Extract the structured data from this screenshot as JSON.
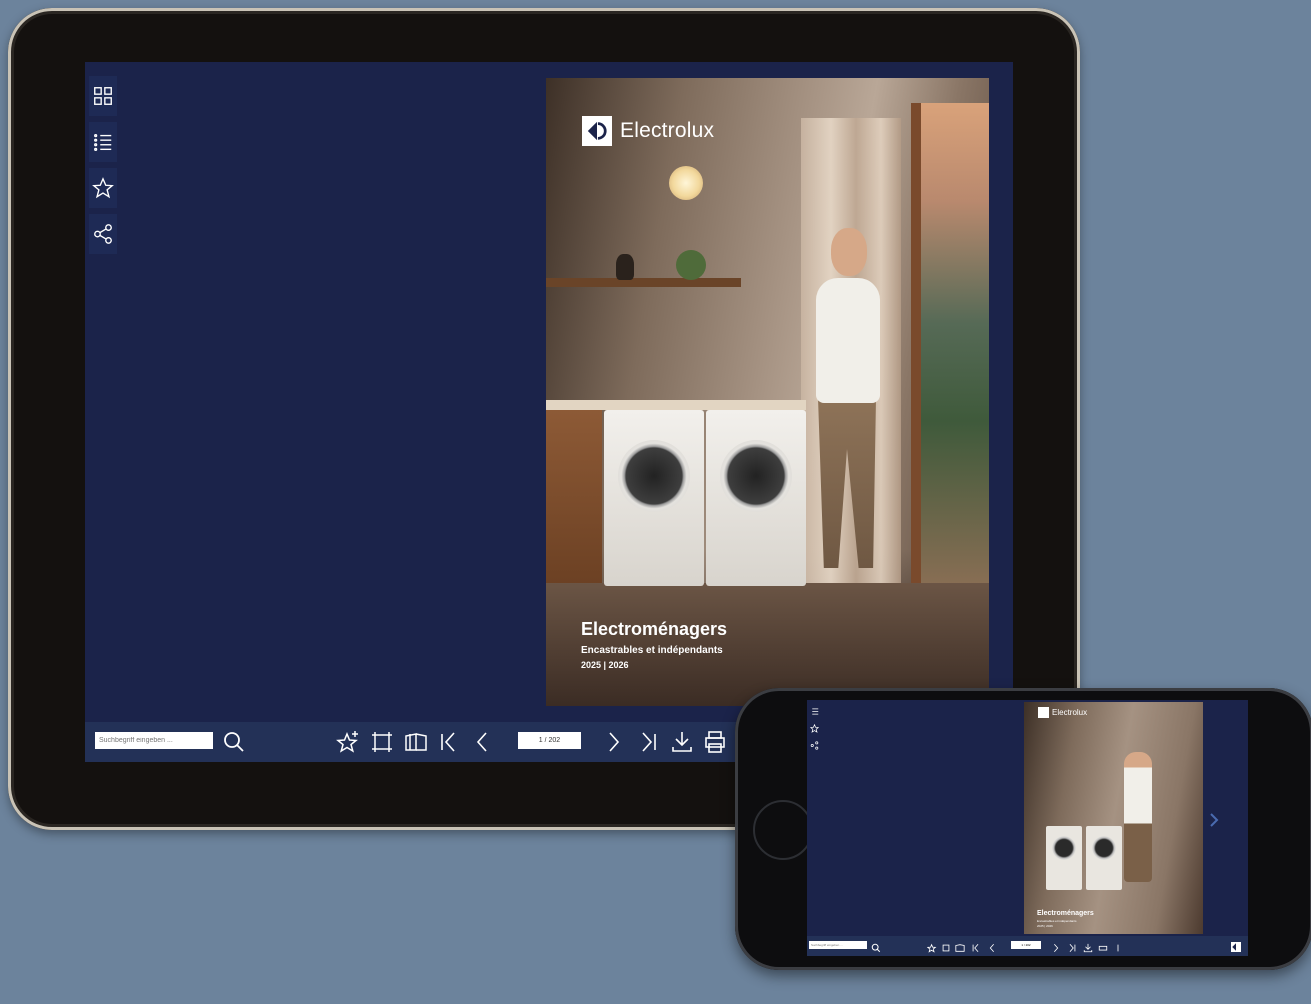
{
  "tablet": {
    "sidebar": {
      "items": [
        {
          "name": "thumbnails",
          "icon": "grid-icon"
        },
        {
          "name": "table-of-contents",
          "icon": "list-icon"
        },
        {
          "name": "bookmarks",
          "icon": "star-icon"
        },
        {
          "name": "share",
          "icon": "share-icon"
        }
      ]
    },
    "cover": {
      "brand": "Electrolux",
      "title": "Electroménagers",
      "subtitle": "Encastrables et indépendants",
      "year": "2025 | 2026"
    },
    "toolbar": {
      "search_placeholder": "Suchbegriff eingeben ...",
      "page_indicator": "1 / 202",
      "icons": [
        "search-icon",
        "add-bookmark-icon",
        "fullscreen-icon",
        "double-page-icon",
        "first-page-icon",
        "previous-page-icon",
        "next-page-icon",
        "last-page-icon",
        "download-icon",
        "print-icon"
      ]
    }
  },
  "phone": {
    "cover": {
      "brand": "Electrolux",
      "title": "Electroménagers",
      "subtitle": "Encastrables et indépendants",
      "year": "2025 | 2026"
    },
    "toolbar": {
      "search_placeholder": "Suchbegriff eingeben ...",
      "page_indicator": "1 / 202"
    }
  },
  "colors": {
    "background": "#6c839c",
    "screen": "#1b234a",
    "toolbar": "#233157",
    "icon": "#ffffff"
  }
}
